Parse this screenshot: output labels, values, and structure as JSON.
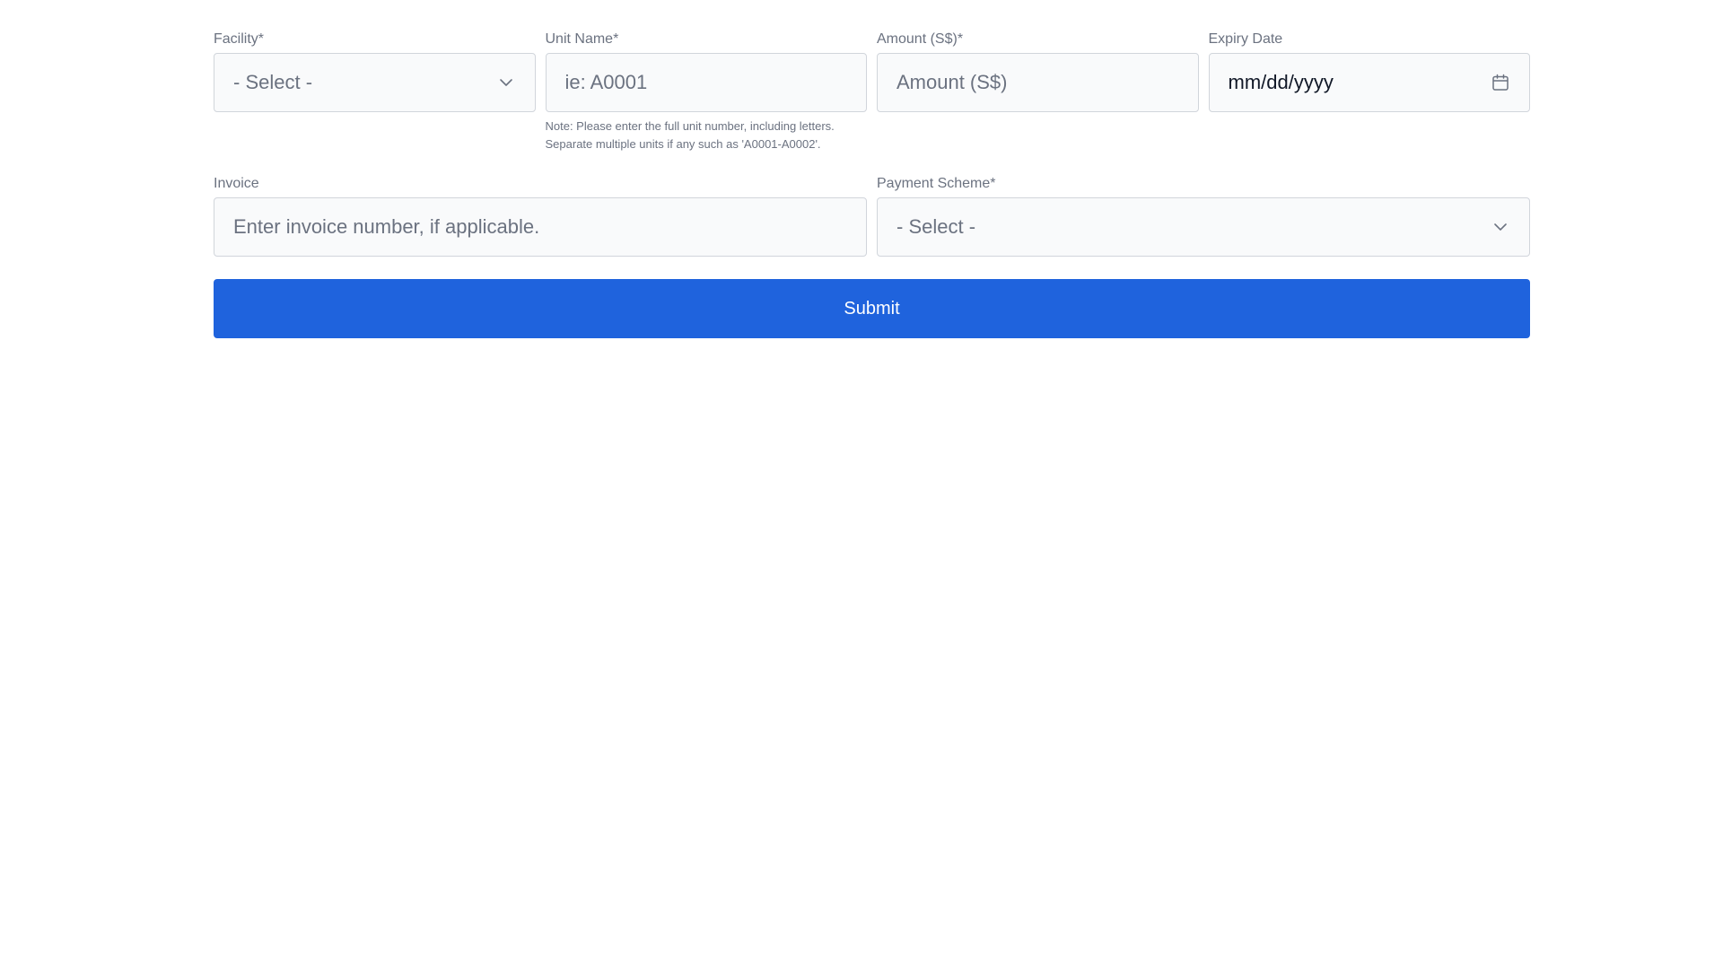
{
  "form": {
    "facility": {
      "label": "Facility*",
      "selected": "- Select -"
    },
    "unit_name": {
      "label": "Unit Name*",
      "value": "",
      "placeholder": "ie: A0001",
      "note_line1": "Note: Please enter the full unit number, including letters.",
      "note_line2": "Separate multiple units if any such as 'A0001-A0002'."
    },
    "amount": {
      "label": "Amount (S$)*",
      "value": "",
      "placeholder": "Amount (S$)"
    },
    "expiry_date": {
      "label": "Expiry Date",
      "display": "mm/dd/yyyy",
      "icon": "calendar-icon"
    },
    "invoice": {
      "label": "Invoice",
      "value": "",
      "placeholder": "Enter invoice number, if applicable."
    },
    "payment_scheme": {
      "label": "Payment Scheme*",
      "selected": "- Select -"
    },
    "submit_label": "Submit"
  },
  "colors": {
    "primary": "#1f63dd",
    "field_bg": "#f9fafb",
    "field_border": "#d1d5db",
    "label_text": "#6b7280"
  }
}
